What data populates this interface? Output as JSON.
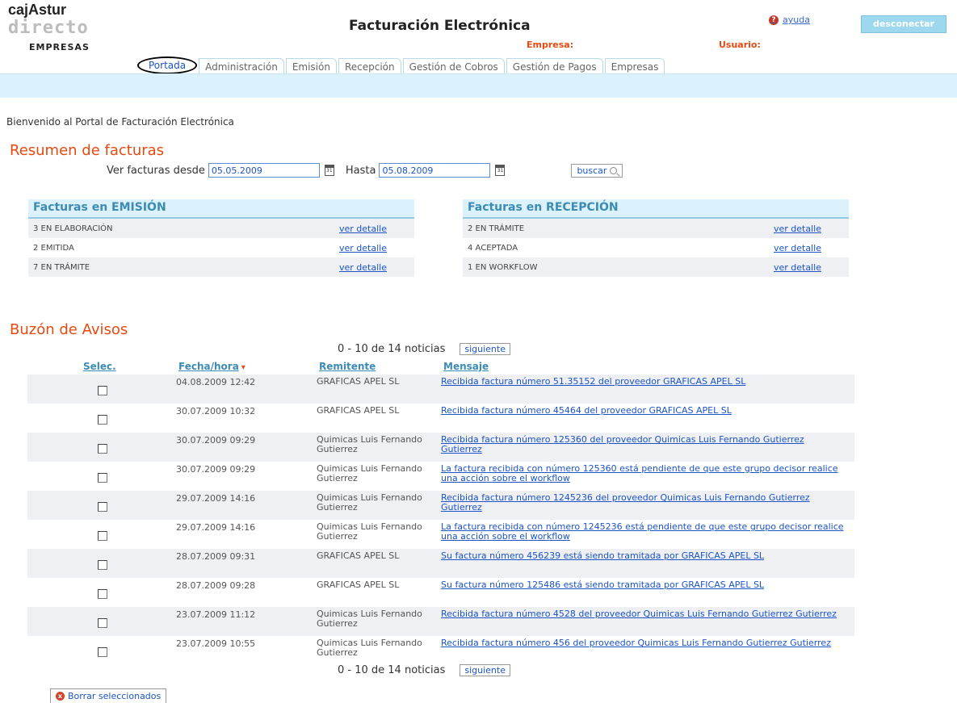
{
  "logo": {
    "line1": "cajAstur",
    "line2": "directo",
    "line3": "EMPRESAS"
  },
  "header": {
    "title": "Facturación Electrónica",
    "empresa_label": "Empresa:",
    "usuario_label": "Usuario:",
    "help_label": "ayuda",
    "help_icon": "?",
    "logout_label": "desconectar"
  },
  "tabs": [
    {
      "label": "Portada",
      "active": true
    },
    {
      "label": "Administración"
    },
    {
      "label": "Emisión"
    },
    {
      "label": "Recepción"
    },
    {
      "label": "Gestión de Cobros"
    },
    {
      "label": "Gestión de Pagos"
    },
    {
      "label": "Empresas"
    }
  ],
  "welcome": "Bienvenido al Portal de Facturación Electrónica",
  "resumen": {
    "title": "Resumen de facturas",
    "desde_label": "Ver facturas desde",
    "desde_value": "05.05.2009",
    "hasta_label": "Hasta",
    "hasta_value": "05.08.2009",
    "calendar_icon_text": "31",
    "buscar_label": "buscar"
  },
  "emision": {
    "title": "Facturas en EMISIÓN",
    "rows": [
      {
        "label": "3  EN ELABORACIÓN",
        "link": "ver detalle"
      },
      {
        "label": "2  EMITIDA",
        "link": "ver detalle"
      },
      {
        "label": "7  EN TRÁMITE",
        "link": "ver detalle"
      }
    ]
  },
  "recepcion": {
    "title": "Facturas en RECEPCIÓN",
    "rows": [
      {
        "label": "2  EN TRÁMITE",
        "link": "ver detalle"
      },
      {
        "label": "4  ACEPTADA",
        "link": "ver detalle"
      },
      {
        "label": "1  EN WORKFLOW",
        "link": "ver detalle"
      }
    ]
  },
  "avisos": {
    "title": "Buzón de Avisos",
    "pager_text": "0 - 10 de 14 noticias",
    "next_label": "siguiente",
    "columns": {
      "sel": "Selec.",
      "fecha": "Fecha/hora",
      "sort_icon": "▾",
      "remitente": "Remitente",
      "mensaje": "Mensaje"
    },
    "rows": [
      {
        "fecha": "04.08.2009 12:42",
        "remitente": "GRAFICAS APEL SL",
        "mensaje": "Recibida factura número 51.35152 del proveedor GRAFICAS APEL SL"
      },
      {
        "fecha": "30.07.2009 10:32",
        "remitente": "GRAFICAS APEL SL",
        "mensaje": "Recibida factura número 45464 del proveedor GRAFICAS APEL SL"
      },
      {
        "fecha": "30.07.2009 09:29",
        "remitente": "Quimicas Luis Fernando Gutierrez",
        "mensaje": "Recibida factura número 125360 del proveedor Quimicas Luis Fernando Gutierrez Gutierrez"
      },
      {
        "fecha": "30.07.2009 09:29",
        "remitente": "Quimicas Luis Fernando Gutierrez",
        "mensaje": "La factura recibida con número 125360 está pendiente de que este grupo decisor realice una acción sobre el workflow"
      },
      {
        "fecha": "29.07.2009 14:16",
        "remitente": "Quimicas Luis Fernando Gutierrez",
        "mensaje": "Recibida factura número 1245236 del proveedor Quimicas Luis Fernando Gutierrez Gutierrez"
      },
      {
        "fecha": "29.07.2009 14:16",
        "remitente": "Quimicas Luis Fernando Gutierrez",
        "mensaje": "La factura recibida con número 1245236 está pendiente de que este grupo decisor realice una acción sobre el workflow"
      },
      {
        "fecha": "28.07.2009 09:31",
        "remitente": "GRAFICAS APEL SL",
        "mensaje": "Su factura número 456239 está siendo tramitada por GRAFICAS APEL SL"
      },
      {
        "fecha": "28.07.2009 09:28",
        "remitente": "GRAFICAS APEL SL",
        "mensaje": "Su factura número 125486 está siendo tramitada por GRAFICAS APEL SL"
      },
      {
        "fecha": "23.07.2009 11:12",
        "remitente": "Quimicas Luis Fernando Gutierrez",
        "mensaje": "Recibida factura número 4528 del proveedor Quimicas Luis Fernando Gutierrez Gutierrez"
      },
      {
        "fecha": "23.07.2009 10:55",
        "remitente": "Quimicas Luis Fernando Gutierrez",
        "mensaje": "Recibida factura número 456 del proveedor Quimicas Luis Fernando Gutierrez Gutierrez"
      }
    ],
    "delete_label": "Borrar seleccionados",
    "delete_icon": "x"
  }
}
